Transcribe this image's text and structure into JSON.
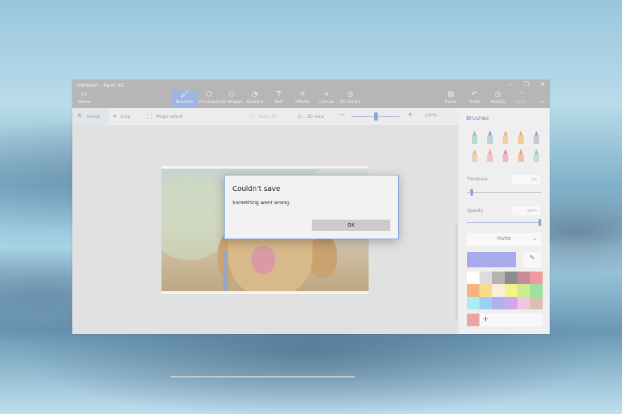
{
  "window": {
    "title": "Untitled* - Paint 3D"
  },
  "window_controls": {
    "minimize": "–",
    "maximize": "❐",
    "close": "✕"
  },
  "toolbar": {
    "menu_label": "Menu",
    "tools": [
      {
        "label": "Brushes",
        "icon": "brush-icon",
        "glyph": "🖌"
      },
      {
        "label": "2D shapes",
        "icon": "2d-shapes-icon",
        "glyph": "⬠"
      },
      {
        "label": "3D shapes",
        "icon": "3d-shapes-icon",
        "glyph": "⬡"
      },
      {
        "label": "Stickers",
        "icon": "stickers-icon",
        "glyph": "◔"
      },
      {
        "label": "Text",
        "icon": "text-icon",
        "glyph": "T"
      },
      {
        "label": "Effects",
        "icon": "effects-icon",
        "glyph": "☼"
      },
      {
        "label": "Canvas",
        "icon": "canvas-icon",
        "glyph": "⌗"
      },
      {
        "label": "3D library",
        "icon": "3d-library-icon",
        "glyph": "◎"
      }
    ],
    "right_tools": [
      {
        "label": "Paste",
        "icon": "paste-icon",
        "glyph": "▤"
      },
      {
        "label": "Undo",
        "icon": "undo-icon",
        "glyph": "↶"
      },
      {
        "label": "History",
        "icon": "history-icon",
        "glyph": "◷"
      },
      {
        "label": "Redo",
        "icon": "redo-icon",
        "glyph": "↷"
      }
    ]
  },
  "subbar": {
    "select_label": "Select",
    "crop_label": "Crop",
    "magic_select_label": "Magic select",
    "make_3d_label": "Make 3D",
    "view_3d_label": "3D view",
    "zoom_minus": "—",
    "zoom_plus": "+",
    "zoom_value": "100%",
    "more": "···"
  },
  "panel": {
    "title": "Brushes",
    "brushes": [
      {
        "icon": "marker-brush-icon",
        "tip": "#8bc3a0",
        "body": "#b8dcc6"
      },
      {
        "icon": "calligraphy-pen-icon",
        "tip": "#7fa4bf",
        "body": "#bcd0de"
      },
      {
        "icon": "oil-brush-icon",
        "tip": "#e5b27e",
        "body": "#efcfa8"
      },
      {
        "icon": "watercolor-icon",
        "tip": "#e6b274",
        "body": "#f0cc9d"
      },
      {
        "icon": "pixel-pen-icon",
        "tip": "#9aa6b6",
        "body": "#c3cad4"
      },
      {
        "icon": "pencil-icon",
        "tip": "#d9b98b",
        "body": "#ead3b0"
      },
      {
        "icon": "eraser-icon",
        "tip": "#e7a3a3",
        "body": "#f0c4c4"
      },
      {
        "icon": "crayon-icon",
        "tip": "#e58aa3",
        "body": "#f0b5c4"
      },
      {
        "icon": "spray-can-icon",
        "tip": "#e8a06f",
        "body": "#f1c29f"
      },
      {
        "icon": "fill-bucket-icon",
        "tip": "#9ec2bd",
        "body": "#c6dcd8"
      }
    ],
    "thickness_label": "Thickness",
    "thickness_value": "1px",
    "thickness_fraction": 0.05,
    "opacity_label": "Opacity",
    "opacity_value": "100%",
    "opacity_fraction": 1.0,
    "finish": "Matte",
    "current_color": "#a9aaeb",
    "palette": [
      "#ffffff",
      "#dcdcdc",
      "#b4b4b4",
      "#8c8c8c",
      "#c88c96",
      "#f09aa0",
      "#f7b37e",
      "#f8dc8c",
      "#f8f0d8",
      "#f4f48a",
      "#c9ee8c",
      "#9ee09e",
      "#a8f0f0",
      "#9ad0f2",
      "#b0b0ee",
      "#d2a8ec",
      "#f2c4e0",
      "#dcc0b0"
    ],
    "custom_color": "#e7a5a5",
    "add_label": "+"
  },
  "dialog": {
    "title": "Couldn't save",
    "message": "Something went wrong.",
    "ok_label": "OK"
  }
}
